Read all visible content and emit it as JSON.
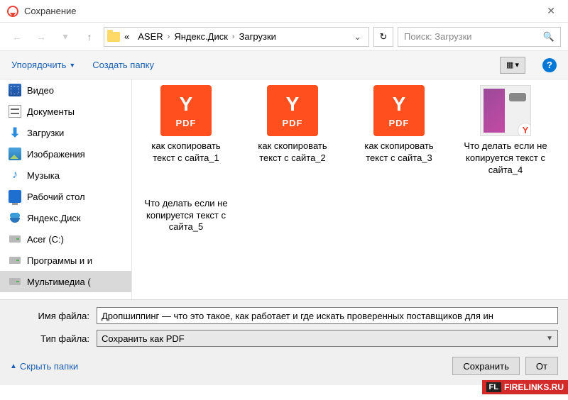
{
  "window": {
    "title": "Сохранение"
  },
  "breadcrumb": {
    "root_marker": "«",
    "parts": [
      "ASER",
      "Яндекс.Диск",
      "Загрузки"
    ]
  },
  "search": {
    "placeholder": "Поиск: Загрузки"
  },
  "toolbar": {
    "organize": "Упорядочить",
    "new_folder": "Создать папку"
  },
  "sidebar": {
    "items": [
      {
        "label": "Видео",
        "icon": "video"
      },
      {
        "label": "Документы",
        "icon": "docs"
      },
      {
        "label": "Загрузки",
        "icon": "download"
      },
      {
        "label": "Изображения",
        "icon": "images"
      },
      {
        "label": "Музыка",
        "icon": "music"
      },
      {
        "label": "Рабочий стол",
        "icon": "desktop"
      },
      {
        "label": "Яндекс.Диск",
        "icon": "ydisk"
      },
      {
        "label": "Acer (C:)",
        "icon": "drive"
      },
      {
        "label": "Программы и и",
        "icon": "drive"
      },
      {
        "label": "Мультимедиа (",
        "icon": "drive",
        "selected": true
      }
    ]
  },
  "files": [
    {
      "label": "как скопировать текст с сайта_1",
      "type": "pdf"
    },
    {
      "label": "как скопировать текст с сайта_2",
      "type": "pdf"
    },
    {
      "label": "как скопировать текст с сайта_3",
      "type": "pdf"
    },
    {
      "label": "Что делать если не копируется текст с сайта_4",
      "type": "image"
    },
    {
      "label": "Что делать если не копируется текст с сайта_5",
      "type": "text"
    }
  ],
  "pdf_badge": "PDF",
  "fields": {
    "filename_label": "Имя файла:",
    "filename_value": "Дропшиппинг — что это такое, как работает и где искать проверенных поставщиков для ин",
    "filetype_label": "Тип файла:",
    "filetype_value": "Сохранить как PDF"
  },
  "actions": {
    "hide_folders": "Скрыть папки",
    "save": "Сохранить",
    "cancel": "От"
  },
  "watermark": {
    "badge": "FL",
    "text": "FIRELINKS.RU"
  }
}
